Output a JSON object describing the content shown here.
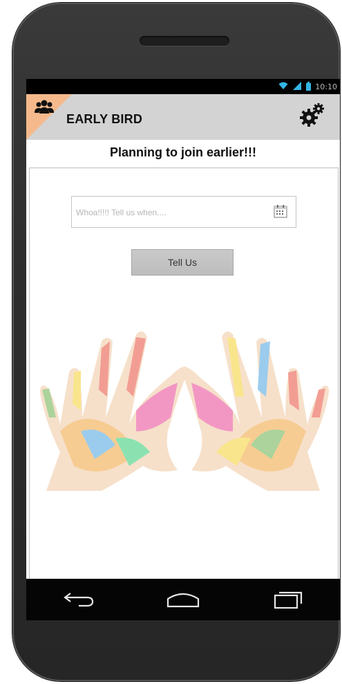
{
  "status_bar": {
    "wifi_icon": "wifi-icon",
    "signal_icon": "signal-icon",
    "battery_icon": "battery-icon",
    "time": "10:10"
  },
  "action_bar": {
    "title": "EARLY BIRD",
    "left_icon": "group-icon",
    "right_icon": "settings-gear-icon",
    "corner_color": "#f5b98c",
    "bar_color": "#d3d3d3"
  },
  "main": {
    "heading": "Planning to join earlier!!!",
    "date_input": {
      "placeholder": "Whoa!!!!! Tell us when....",
      "value": "",
      "icon": "calendar-icon"
    },
    "submit_label": "Tell Us",
    "illustration": "painted-hands-heart"
  },
  "nav_bar": {
    "back_icon": "back-icon",
    "home_icon": "home-icon",
    "recents_icon": "recents-icon"
  }
}
